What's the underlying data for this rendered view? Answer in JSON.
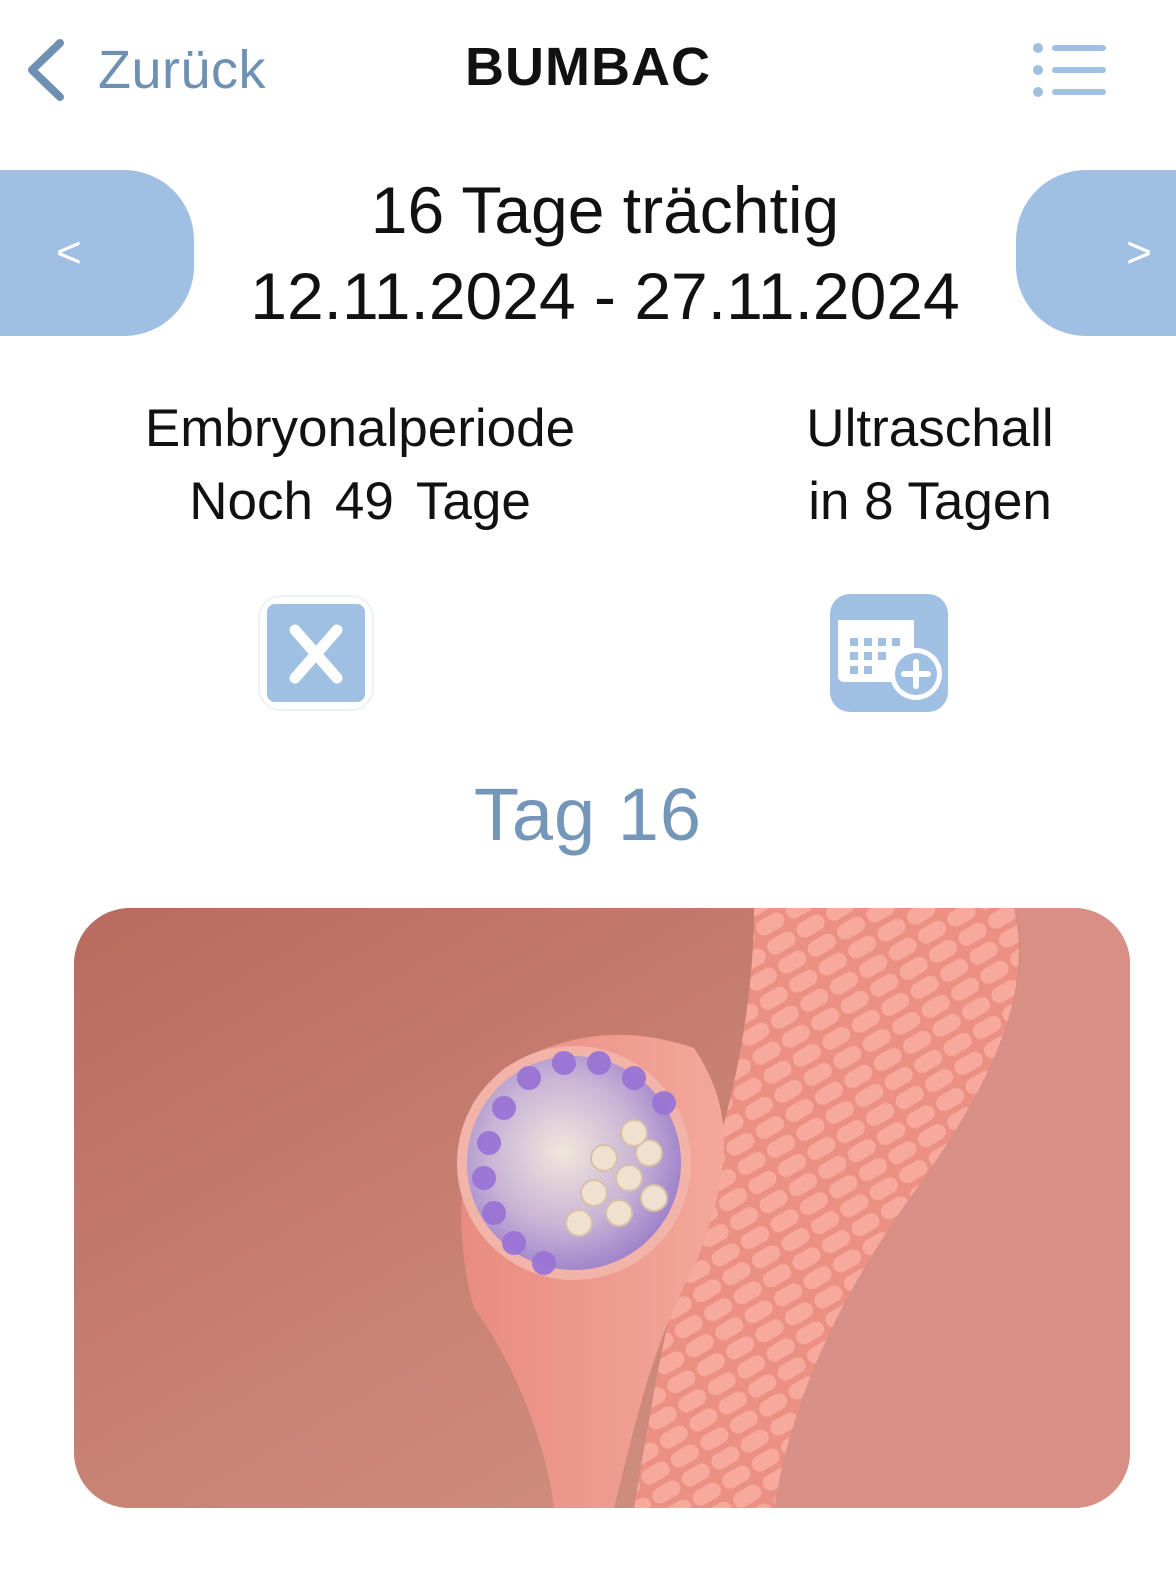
{
  "nav": {
    "back_label": "Zurück",
    "title": "BUMBAC",
    "menu_icon": "list-icon"
  },
  "pager": {
    "prev_label": "<",
    "next_label": ">"
  },
  "pregnancy": {
    "days_label": "16 Tage trächtig",
    "date_range": "12.11.2024 - 27.11.2024"
  },
  "period": {
    "name": "Embryonalperiode",
    "remaining_prefix": "Noch",
    "remaining_days": "49",
    "remaining_suffix": "Tage"
  },
  "ultrasound": {
    "name": "Ultraschall",
    "countdown": "in 8 Tagen"
  },
  "actions": {
    "left_icon": "x-close-icon",
    "right_icon": "calendar-add-icon"
  },
  "day": {
    "title": "Tag 16"
  },
  "colors": {
    "accent": "#9fbfe3",
    "nav_text": "#6e91b3",
    "day_title": "#7496b8"
  }
}
